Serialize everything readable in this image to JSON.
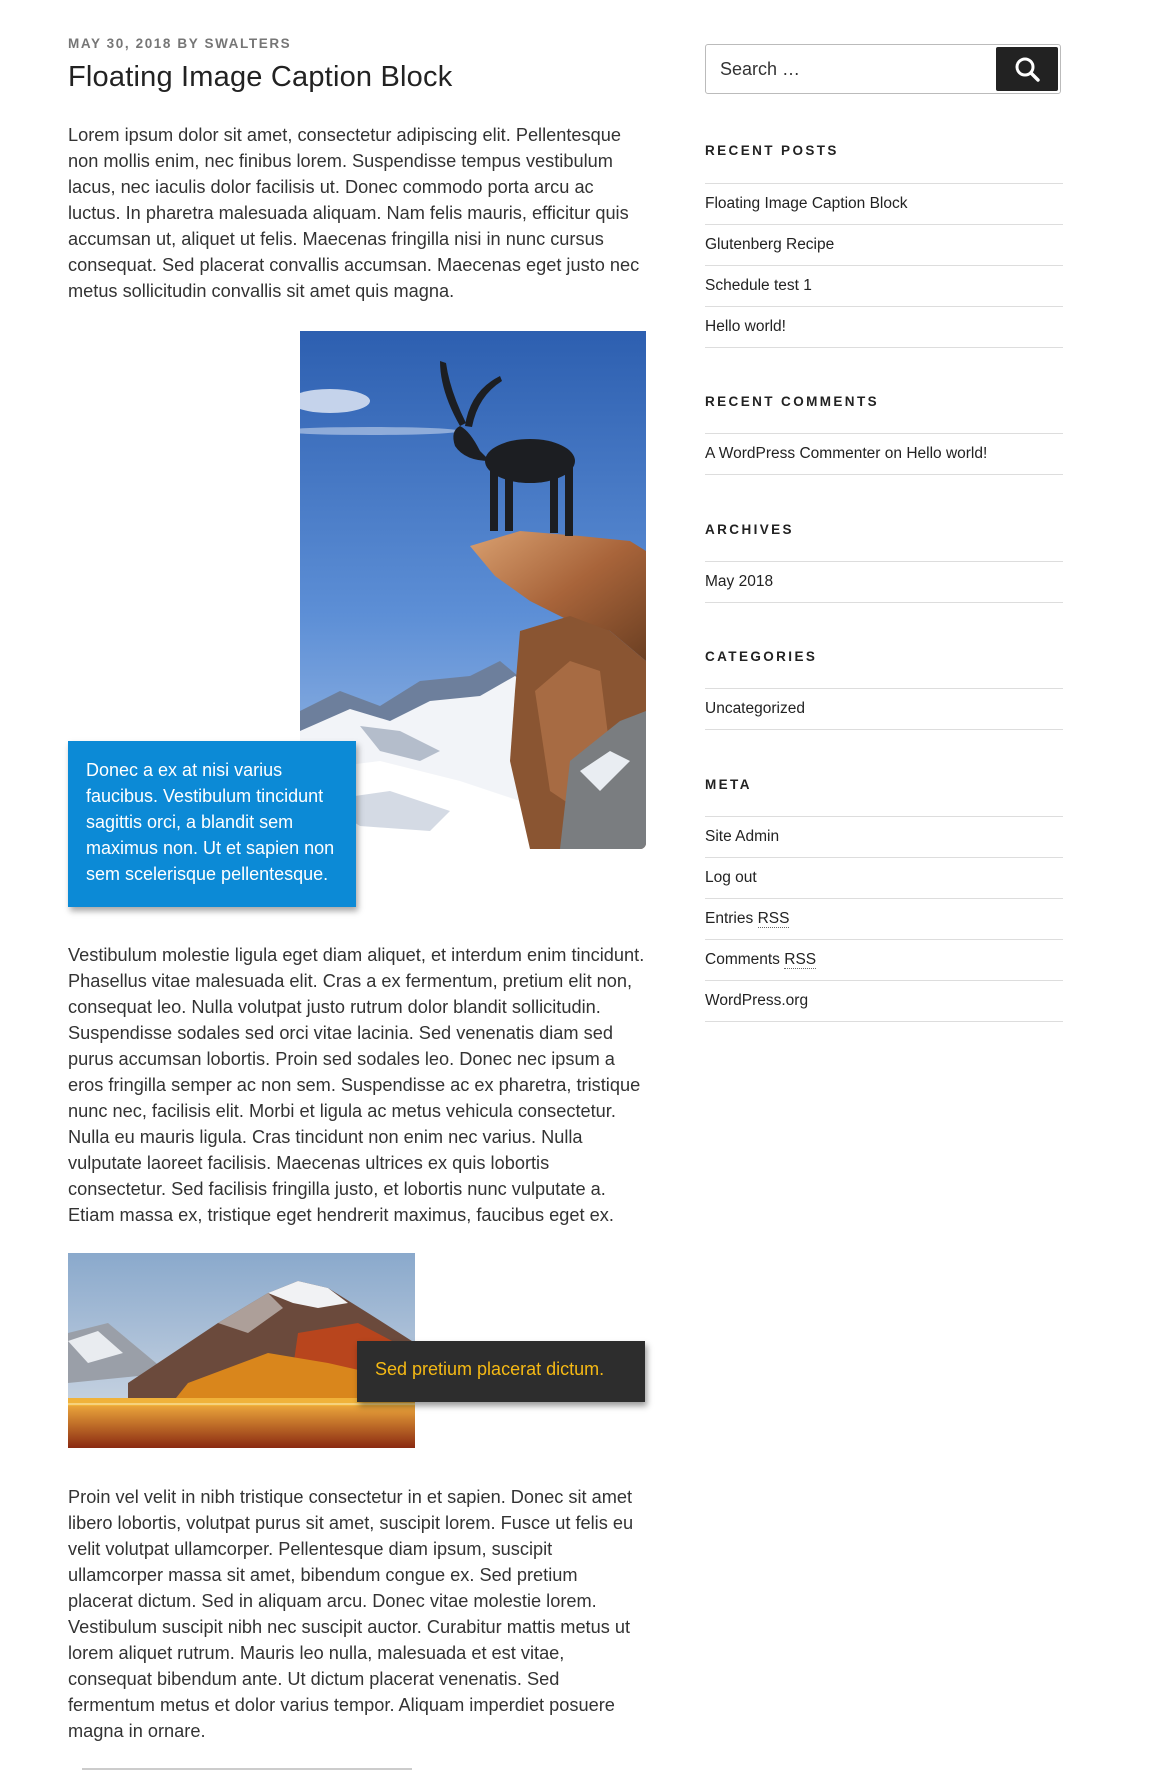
{
  "post": {
    "meta_date": "MAY 30, 2018",
    "meta_by": "BY",
    "meta_author": "SWALTERS",
    "title": "Floating Image Caption Block",
    "paragraph1": "Lorem ipsum dolor sit amet, consectetur adipiscing elit. Pellentesque non mollis enim, nec finibus lorem. Suspendisse tempus vestibulum lacus, nec iaculis dolor facilisis ut. Donec commodo porta arcu ac luctus. In pharetra malesuada aliquam. Nam felis mauris, efficitur quis accumsan ut, aliquet ut felis. Maecenas fringilla nisi in nunc cursus consequat. Sed placerat convallis accumsan. Maecenas eget justo nec metus sollicitudin convallis sit amet quis magna.",
    "figure1_caption": "Donec a ex at nisi varius faucibus. Vestibulum tincidunt sagittis orci, a blandit sem maximus non. Ut et sapien non sem scelerisque pellentesque.",
    "paragraph2": "Vestibulum molestie ligula eget diam aliquet, et interdum enim tincidunt. Phasellus vitae malesuada elit. Cras a ex fermentum, pretium elit non, consequat leo. Nulla volutpat justo rutrum dolor blandit sollicitudin. Suspendisse sodales sed orci vitae lacinia. Sed venenatis diam sed purus accumsan lobortis. Proin sed sodales leo. Donec nec ipsum a eros fringilla semper ac non sem. Suspendisse ac ex pharetra, tristique nunc nec, facilisis elit. Morbi et ligula ac metus vehicula consectetur. Nulla eu mauris ligula. Cras tincidunt non enim nec varius. Nulla vulputate laoreet facilisis. Maecenas ultrices ex quis lobortis consectetur. Sed facilisis fringilla justo, et lobortis nunc vulputate a. Etiam massa ex, tristique eget hendrerit maximus, faucibus eget ex.",
    "figure2_caption": "Sed pretium placerat dictum.",
    "paragraph3": "Proin vel velit in nibh tristique consectetur in et sapien. Donec sit amet libero lobortis, volutpat purus sit amet, suscipit lorem. Fusce ut felis eu velit volutpat ullamcorper. Pellentesque diam ipsum, suscipit ullamcorper massa sit amet, bibendum congue ex. Sed pretium placerat dictum. Sed in aliquam arcu. Donec vitae molestie lorem. Vestibulum suscipit nibh nec suscipit auctor. Curabitur mattis metus ut lorem aliquet rutrum. Mauris leo nulla, malesuada et est vitae, consequat bibendum ante. Ut dictum placerat venenatis. Sed fermentum metus et dolor varius tempor. Aliquam imperdiet posuere magna in ornare."
  },
  "sidebar": {
    "search": {
      "placeholder": "Search …",
      "icon": "search-icon"
    },
    "recent_posts": {
      "title": "RECENT POSTS",
      "items": [
        "Floating Image Caption Block",
        "Glutenberg Recipe",
        "Schedule test 1",
        "Hello world!"
      ]
    },
    "recent_comments": {
      "title": "RECENT COMMENTS",
      "author": "A WordPress Commenter",
      "on": "on",
      "post": "Hello world!"
    },
    "archives": {
      "title": "ARCHIVES",
      "items": [
        "May 2018"
      ]
    },
    "categories": {
      "title": "CATEGORIES",
      "items": [
        "Uncategorized"
      ]
    },
    "meta": {
      "title": "META",
      "site_admin": "Site Admin",
      "log_out": "Log out",
      "entries_prefix": "Entries",
      "comments_prefix": "Comments",
      "rss": "RSS",
      "wordpress_org": "WordPress.org"
    }
  },
  "colors": {
    "caption1_bg": "#0c8ad6",
    "caption2_bg": "#2d2d2d",
    "caption2_text": "#f5b914"
  }
}
